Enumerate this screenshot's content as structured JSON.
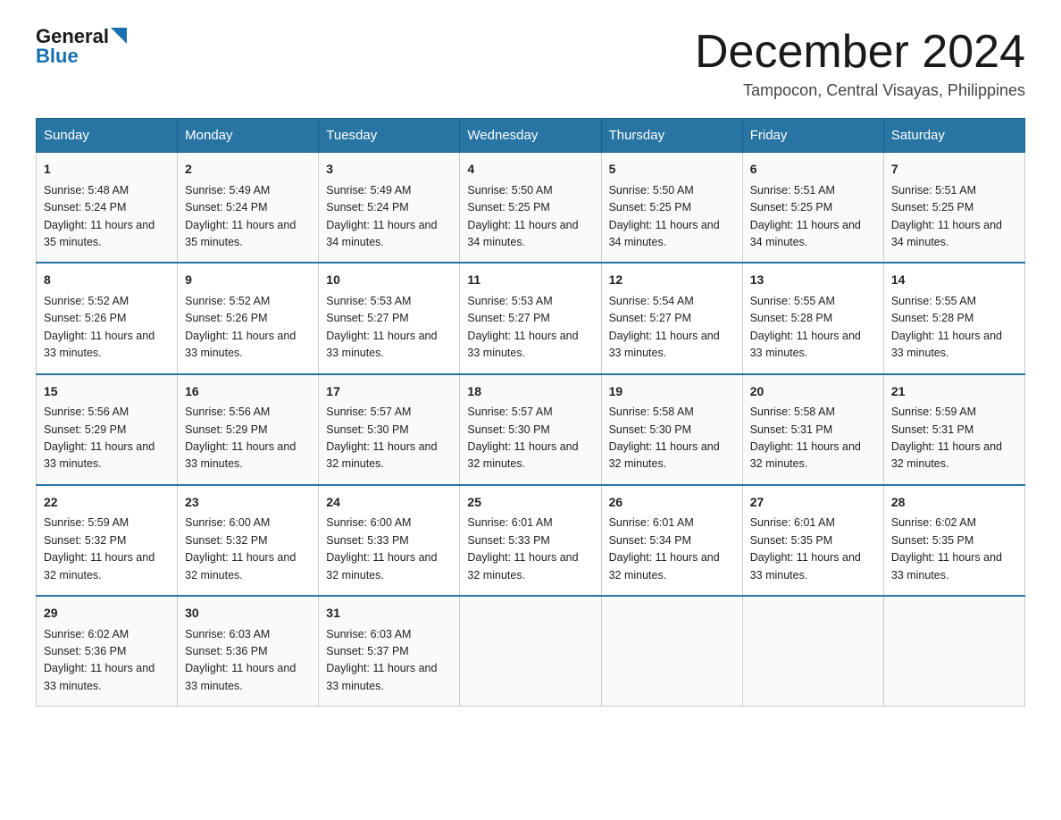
{
  "header": {
    "logo_general": "General",
    "logo_blue": "Blue",
    "month_title": "December 2024",
    "location": "Tampocon, Central Visayas, Philippines"
  },
  "weekdays": [
    "Sunday",
    "Monday",
    "Tuesday",
    "Wednesday",
    "Thursday",
    "Friday",
    "Saturday"
  ],
  "weeks": [
    [
      {
        "day": "1",
        "sunrise": "5:48 AM",
        "sunset": "5:24 PM",
        "daylight": "11 hours and 35 minutes."
      },
      {
        "day": "2",
        "sunrise": "5:49 AM",
        "sunset": "5:24 PM",
        "daylight": "11 hours and 35 minutes."
      },
      {
        "day": "3",
        "sunrise": "5:49 AM",
        "sunset": "5:24 PM",
        "daylight": "11 hours and 34 minutes."
      },
      {
        "day": "4",
        "sunrise": "5:50 AM",
        "sunset": "5:25 PM",
        "daylight": "11 hours and 34 minutes."
      },
      {
        "day": "5",
        "sunrise": "5:50 AM",
        "sunset": "5:25 PM",
        "daylight": "11 hours and 34 minutes."
      },
      {
        "day": "6",
        "sunrise": "5:51 AM",
        "sunset": "5:25 PM",
        "daylight": "11 hours and 34 minutes."
      },
      {
        "day": "7",
        "sunrise": "5:51 AM",
        "sunset": "5:25 PM",
        "daylight": "11 hours and 34 minutes."
      }
    ],
    [
      {
        "day": "8",
        "sunrise": "5:52 AM",
        "sunset": "5:26 PM",
        "daylight": "11 hours and 33 minutes."
      },
      {
        "day": "9",
        "sunrise": "5:52 AM",
        "sunset": "5:26 PM",
        "daylight": "11 hours and 33 minutes."
      },
      {
        "day": "10",
        "sunrise": "5:53 AM",
        "sunset": "5:27 PM",
        "daylight": "11 hours and 33 minutes."
      },
      {
        "day": "11",
        "sunrise": "5:53 AM",
        "sunset": "5:27 PM",
        "daylight": "11 hours and 33 minutes."
      },
      {
        "day": "12",
        "sunrise": "5:54 AM",
        "sunset": "5:27 PM",
        "daylight": "11 hours and 33 minutes."
      },
      {
        "day": "13",
        "sunrise": "5:55 AM",
        "sunset": "5:28 PM",
        "daylight": "11 hours and 33 minutes."
      },
      {
        "day": "14",
        "sunrise": "5:55 AM",
        "sunset": "5:28 PM",
        "daylight": "11 hours and 33 minutes."
      }
    ],
    [
      {
        "day": "15",
        "sunrise": "5:56 AM",
        "sunset": "5:29 PM",
        "daylight": "11 hours and 33 minutes."
      },
      {
        "day": "16",
        "sunrise": "5:56 AM",
        "sunset": "5:29 PM",
        "daylight": "11 hours and 33 minutes."
      },
      {
        "day": "17",
        "sunrise": "5:57 AM",
        "sunset": "5:30 PM",
        "daylight": "11 hours and 32 minutes."
      },
      {
        "day": "18",
        "sunrise": "5:57 AM",
        "sunset": "5:30 PM",
        "daylight": "11 hours and 32 minutes."
      },
      {
        "day": "19",
        "sunrise": "5:58 AM",
        "sunset": "5:30 PM",
        "daylight": "11 hours and 32 minutes."
      },
      {
        "day": "20",
        "sunrise": "5:58 AM",
        "sunset": "5:31 PM",
        "daylight": "11 hours and 32 minutes."
      },
      {
        "day": "21",
        "sunrise": "5:59 AM",
        "sunset": "5:31 PM",
        "daylight": "11 hours and 32 minutes."
      }
    ],
    [
      {
        "day": "22",
        "sunrise": "5:59 AM",
        "sunset": "5:32 PM",
        "daylight": "11 hours and 32 minutes."
      },
      {
        "day": "23",
        "sunrise": "6:00 AM",
        "sunset": "5:32 PM",
        "daylight": "11 hours and 32 minutes."
      },
      {
        "day": "24",
        "sunrise": "6:00 AM",
        "sunset": "5:33 PM",
        "daylight": "11 hours and 32 minutes."
      },
      {
        "day": "25",
        "sunrise": "6:01 AM",
        "sunset": "5:33 PM",
        "daylight": "11 hours and 32 minutes."
      },
      {
        "day": "26",
        "sunrise": "6:01 AM",
        "sunset": "5:34 PM",
        "daylight": "11 hours and 32 minutes."
      },
      {
        "day": "27",
        "sunrise": "6:01 AM",
        "sunset": "5:35 PM",
        "daylight": "11 hours and 33 minutes."
      },
      {
        "day": "28",
        "sunrise": "6:02 AM",
        "sunset": "5:35 PM",
        "daylight": "11 hours and 33 minutes."
      }
    ],
    [
      {
        "day": "29",
        "sunrise": "6:02 AM",
        "sunset": "5:36 PM",
        "daylight": "11 hours and 33 minutes."
      },
      {
        "day": "30",
        "sunrise": "6:03 AM",
        "sunset": "5:36 PM",
        "daylight": "11 hours and 33 minutes."
      },
      {
        "day": "31",
        "sunrise": "6:03 AM",
        "sunset": "5:37 PM",
        "daylight": "11 hours and 33 minutes."
      },
      null,
      null,
      null,
      null
    ]
  ]
}
